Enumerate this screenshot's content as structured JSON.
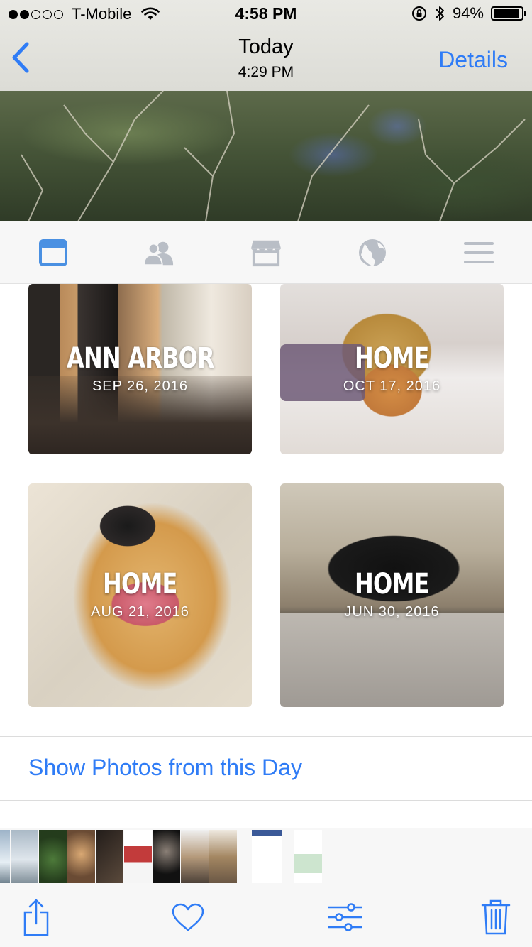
{
  "status_bar": {
    "signal_filled": 2,
    "signal_total": 5,
    "carrier": "T-Mobile",
    "time": "4:58 PM",
    "battery_label": "94%",
    "battery_level": 0.94,
    "icons": [
      "wifi-icon",
      "rotation-lock-icon",
      "bluetooth-icon",
      "battery-icon"
    ]
  },
  "nav": {
    "back_icon": "chevron-left-icon",
    "title": "Today",
    "subtitle": "4:29 PM",
    "details_label": "Details"
  },
  "tabs": [
    {
      "icon": "news-feed-icon",
      "active": true
    },
    {
      "icon": "friends-icon",
      "active": false
    },
    {
      "icon": "marketplace-icon",
      "active": false
    },
    {
      "icon": "globe-icon",
      "active": false
    },
    {
      "icon": "menu-icon",
      "active": false
    }
  ],
  "memories": [
    {
      "place": "ANN ARBOR",
      "date": "SEP 26, 2016"
    },
    {
      "place": "HOME",
      "date": "OCT 17, 2016"
    },
    {
      "place": "HOME",
      "date": "AUG 21, 2016"
    },
    {
      "place": "HOME",
      "date": "JUN 30, 2016"
    }
  ],
  "show_photos_label": "Show Photos from this Day",
  "toolbar": {
    "share_icon": "share-icon",
    "favorite_icon": "heart-icon",
    "edit_icon": "sliders-icon",
    "delete_icon": "trash-icon"
  },
  "colors": {
    "accent": "#2f7cf6",
    "tab_active": "#4a90e2",
    "tab_inactive": "#b9bec6"
  }
}
